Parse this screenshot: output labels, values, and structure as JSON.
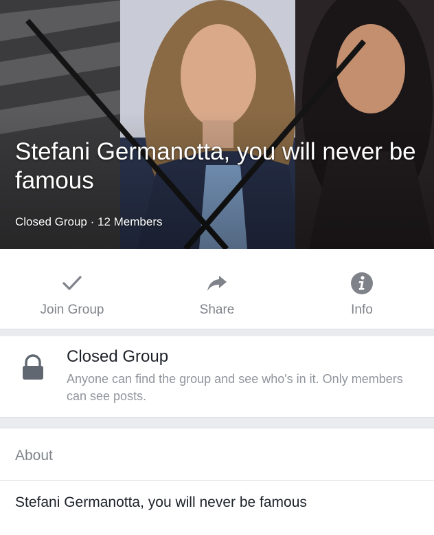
{
  "group": {
    "title": "Stefani Germanotta, you will never be famous",
    "privacy_label": "Closed Group",
    "meta_separator": " · ",
    "member_count": "12 Members"
  },
  "actions": [
    {
      "label": "Join Group",
      "icon": "checkmark-icon"
    },
    {
      "label": "Share",
      "icon": "share-arrow-icon"
    },
    {
      "label": "Info",
      "icon": "info-icon"
    }
  ],
  "privacy": {
    "icon": "lock-icon",
    "title": "Closed Group",
    "description": "Anyone can find the group and see who's in it. Only members can see posts."
  },
  "about": {
    "heading": "About",
    "text": "Stefani Germanotta, you will never be famous"
  },
  "colors": {
    "icon_gray": "#7f8389",
    "text_dark": "#1d2129",
    "text_gray": "#90949c",
    "background": "#e9ebee"
  }
}
